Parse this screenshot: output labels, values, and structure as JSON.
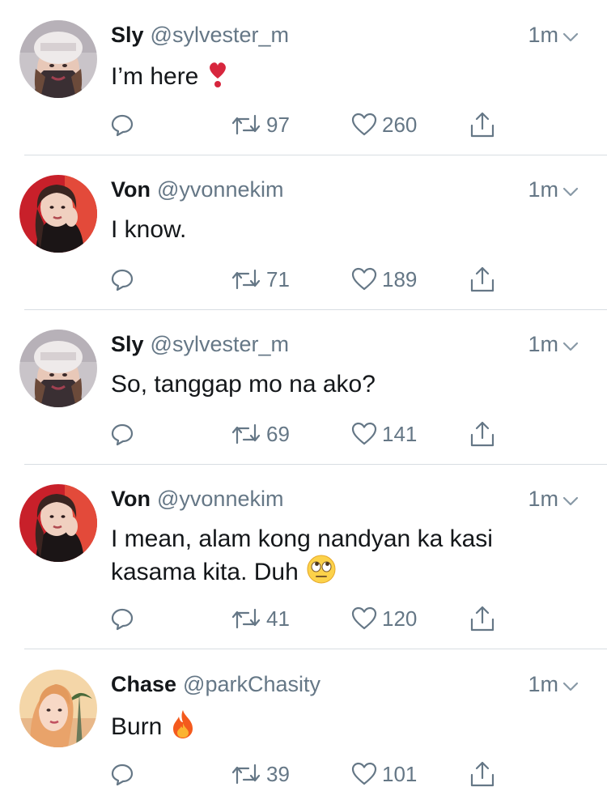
{
  "tweets": [
    {
      "name": "Sly",
      "handle": "@sylvester_m",
      "time": "1m",
      "line1": "I’m here",
      "line2": "",
      "emoji": "heart-exclamation-emoji",
      "retweets": "97",
      "likes": "260"
    },
    {
      "name": "Von",
      "handle": "@yvonnekim",
      "time": "1m",
      "line1": "I know.",
      "line2": "",
      "emoji": "",
      "retweets": "71",
      "likes": "189"
    },
    {
      "name": "Sly",
      "handle": "@sylvester_m",
      "time": "1m",
      "line1": "So, tanggap mo na ako?",
      "line2": "",
      "emoji": "",
      "retweets": "69",
      "likes": "141"
    },
    {
      "name": "Von",
      "handle": "@yvonnekim",
      "time": "1m",
      "line1": "I mean, alam kong nandyan ka kasi",
      "line2": "kasama kita. Duh",
      "emoji": "eye-roll-emoji",
      "retweets": "41",
      "likes": "120"
    },
    {
      "name": "Chase",
      "handle": "@parkChasity",
      "time": "1m",
      "line1": "Burn",
      "line2": "",
      "emoji": "fire-emoji",
      "retweets": "39",
      "likes": "101"
    }
  ],
  "colors": {
    "text": "#14171a",
    "muted": "#657786",
    "separator": "#d8dde2"
  }
}
